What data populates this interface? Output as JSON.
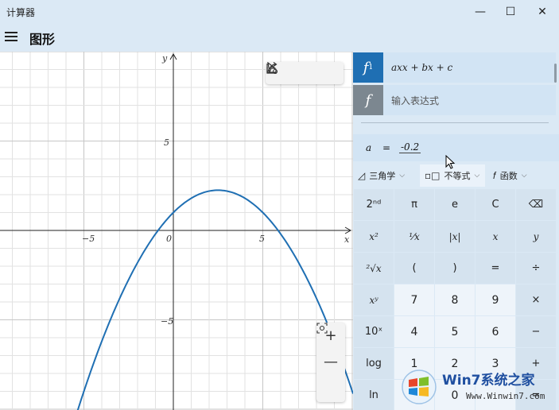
{
  "window": {
    "title": "计算器",
    "controls": {
      "minimize": "—",
      "maximize": "☐",
      "close": "✕"
    }
  },
  "header": {
    "mode_title": "图形",
    "menu_icon": "hamburger-icon"
  },
  "graph": {
    "x_axis_label": "x",
    "y_axis_label": "y",
    "x_tick_labels": [
      "−5",
      "0",
      "5"
    ],
    "y_tick_labels": [
      "5",
      "−5"
    ],
    "curve_color": "#1f6fb3",
    "toolbar_icons": [
      "pointer-icon",
      "share-icon",
      "graph-settings-icon"
    ],
    "zoom": {
      "in": "+",
      "out": "—",
      "fit_icon": "zoom-fit-icon"
    }
  },
  "chart_data": {
    "type": "line",
    "title": "",
    "xlabel": "x",
    "ylabel": "y",
    "xlim": [
      -9.7,
      9.9
    ],
    "ylim": [
      -10.9,
      10.2
    ],
    "grid": true,
    "series": [
      {
        "expression": "-0.2x^2 + x + 1",
        "color": "#1f6fb3",
        "x": [
          -6,
          -5,
          -4,
          -3,
          -2,
          -1,
          0,
          1,
          2,
          2.5,
          3,
          4,
          5,
          6,
          7,
          8,
          9,
          10
        ],
        "y": [
          -12.2,
          -9,
          -6.2,
          -3.8,
          -1.8,
          -0.2,
          1,
          1.8,
          2.2,
          2.25,
          2.2,
          1.8,
          1,
          -0.2,
          -1.8,
          -3.8,
          -6.2,
          -9
        ]
      }
    ]
  },
  "functions": [
    {
      "badge": "f",
      "subscript": "1",
      "expression": "axx + bx + c",
      "color": "#1f6fb3"
    },
    {
      "badge": "f",
      "subscript": "",
      "placeholder": "输入表达式",
      "color": "#7c8790"
    }
  ],
  "variables": [
    {
      "name": "a",
      "equals": "=",
      "value": "-0.2"
    }
  ],
  "dropdowns": {
    "trig": {
      "icon": "◿",
      "label": "三角学"
    },
    "inequality": {
      "icon": "▫□",
      "label": "不等式"
    },
    "function": {
      "icon": "𝑓",
      "label": "函数"
    },
    "chevron": "⌵"
  },
  "keypad": [
    [
      "2ⁿᵈ",
      "π",
      "e",
      "C",
      "⌫"
    ],
    [
      "x²",
      "¹⁄x",
      "|x|",
      "x",
      "y"
    ],
    [
      "²√x",
      "(",
      ")",
      "=",
      "÷"
    ],
    [
      "xʸ",
      "7",
      "8",
      "9",
      "×"
    ],
    [
      "10ˣ",
      "4",
      "5",
      "6",
      "−"
    ],
    [
      "log",
      "1",
      "2",
      "3",
      "+"
    ],
    [
      "ln",
      "",
      "0",
      "",
      "="
    ]
  ],
  "watermark": {
    "title": "Win7系统之家",
    "url": "Www.Winwin7.com"
  }
}
